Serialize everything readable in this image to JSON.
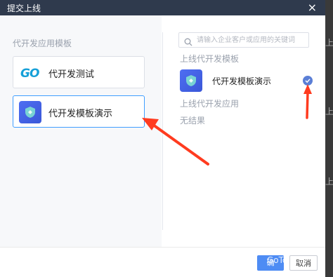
{
  "dialog": {
    "title": "提交上线",
    "close_glyph": "×"
  },
  "left": {
    "section_title": "代开发应用模板",
    "cards": [
      {
        "name": "代开发测试",
        "logo_text": "GO"
      },
      {
        "name": "代开发模板演示"
      }
    ]
  },
  "right": {
    "search_placeholder": "请输入企业客户或应用的关键词",
    "online_templates_label": "上线代开发模板",
    "online_item_name": "代开发模板演示",
    "online_apps_label": "上线代开发应用",
    "no_results": "无结果"
  },
  "footer": {
    "ok_label": "确",
    "cancel_label": "取消"
  },
  "watermark": "GoTo Iioji",
  "colors": {
    "titlebar": "#2f3a4d",
    "accent": "#4e8cf4",
    "arrow": "#ff3b1f",
    "app_icon": "#4e6ef2",
    "check": "#5b7fd6"
  },
  "icons": {
    "close": "close-icon",
    "search": "search-icon",
    "check": "check-circle-icon",
    "app": "shield-app-icon"
  }
}
